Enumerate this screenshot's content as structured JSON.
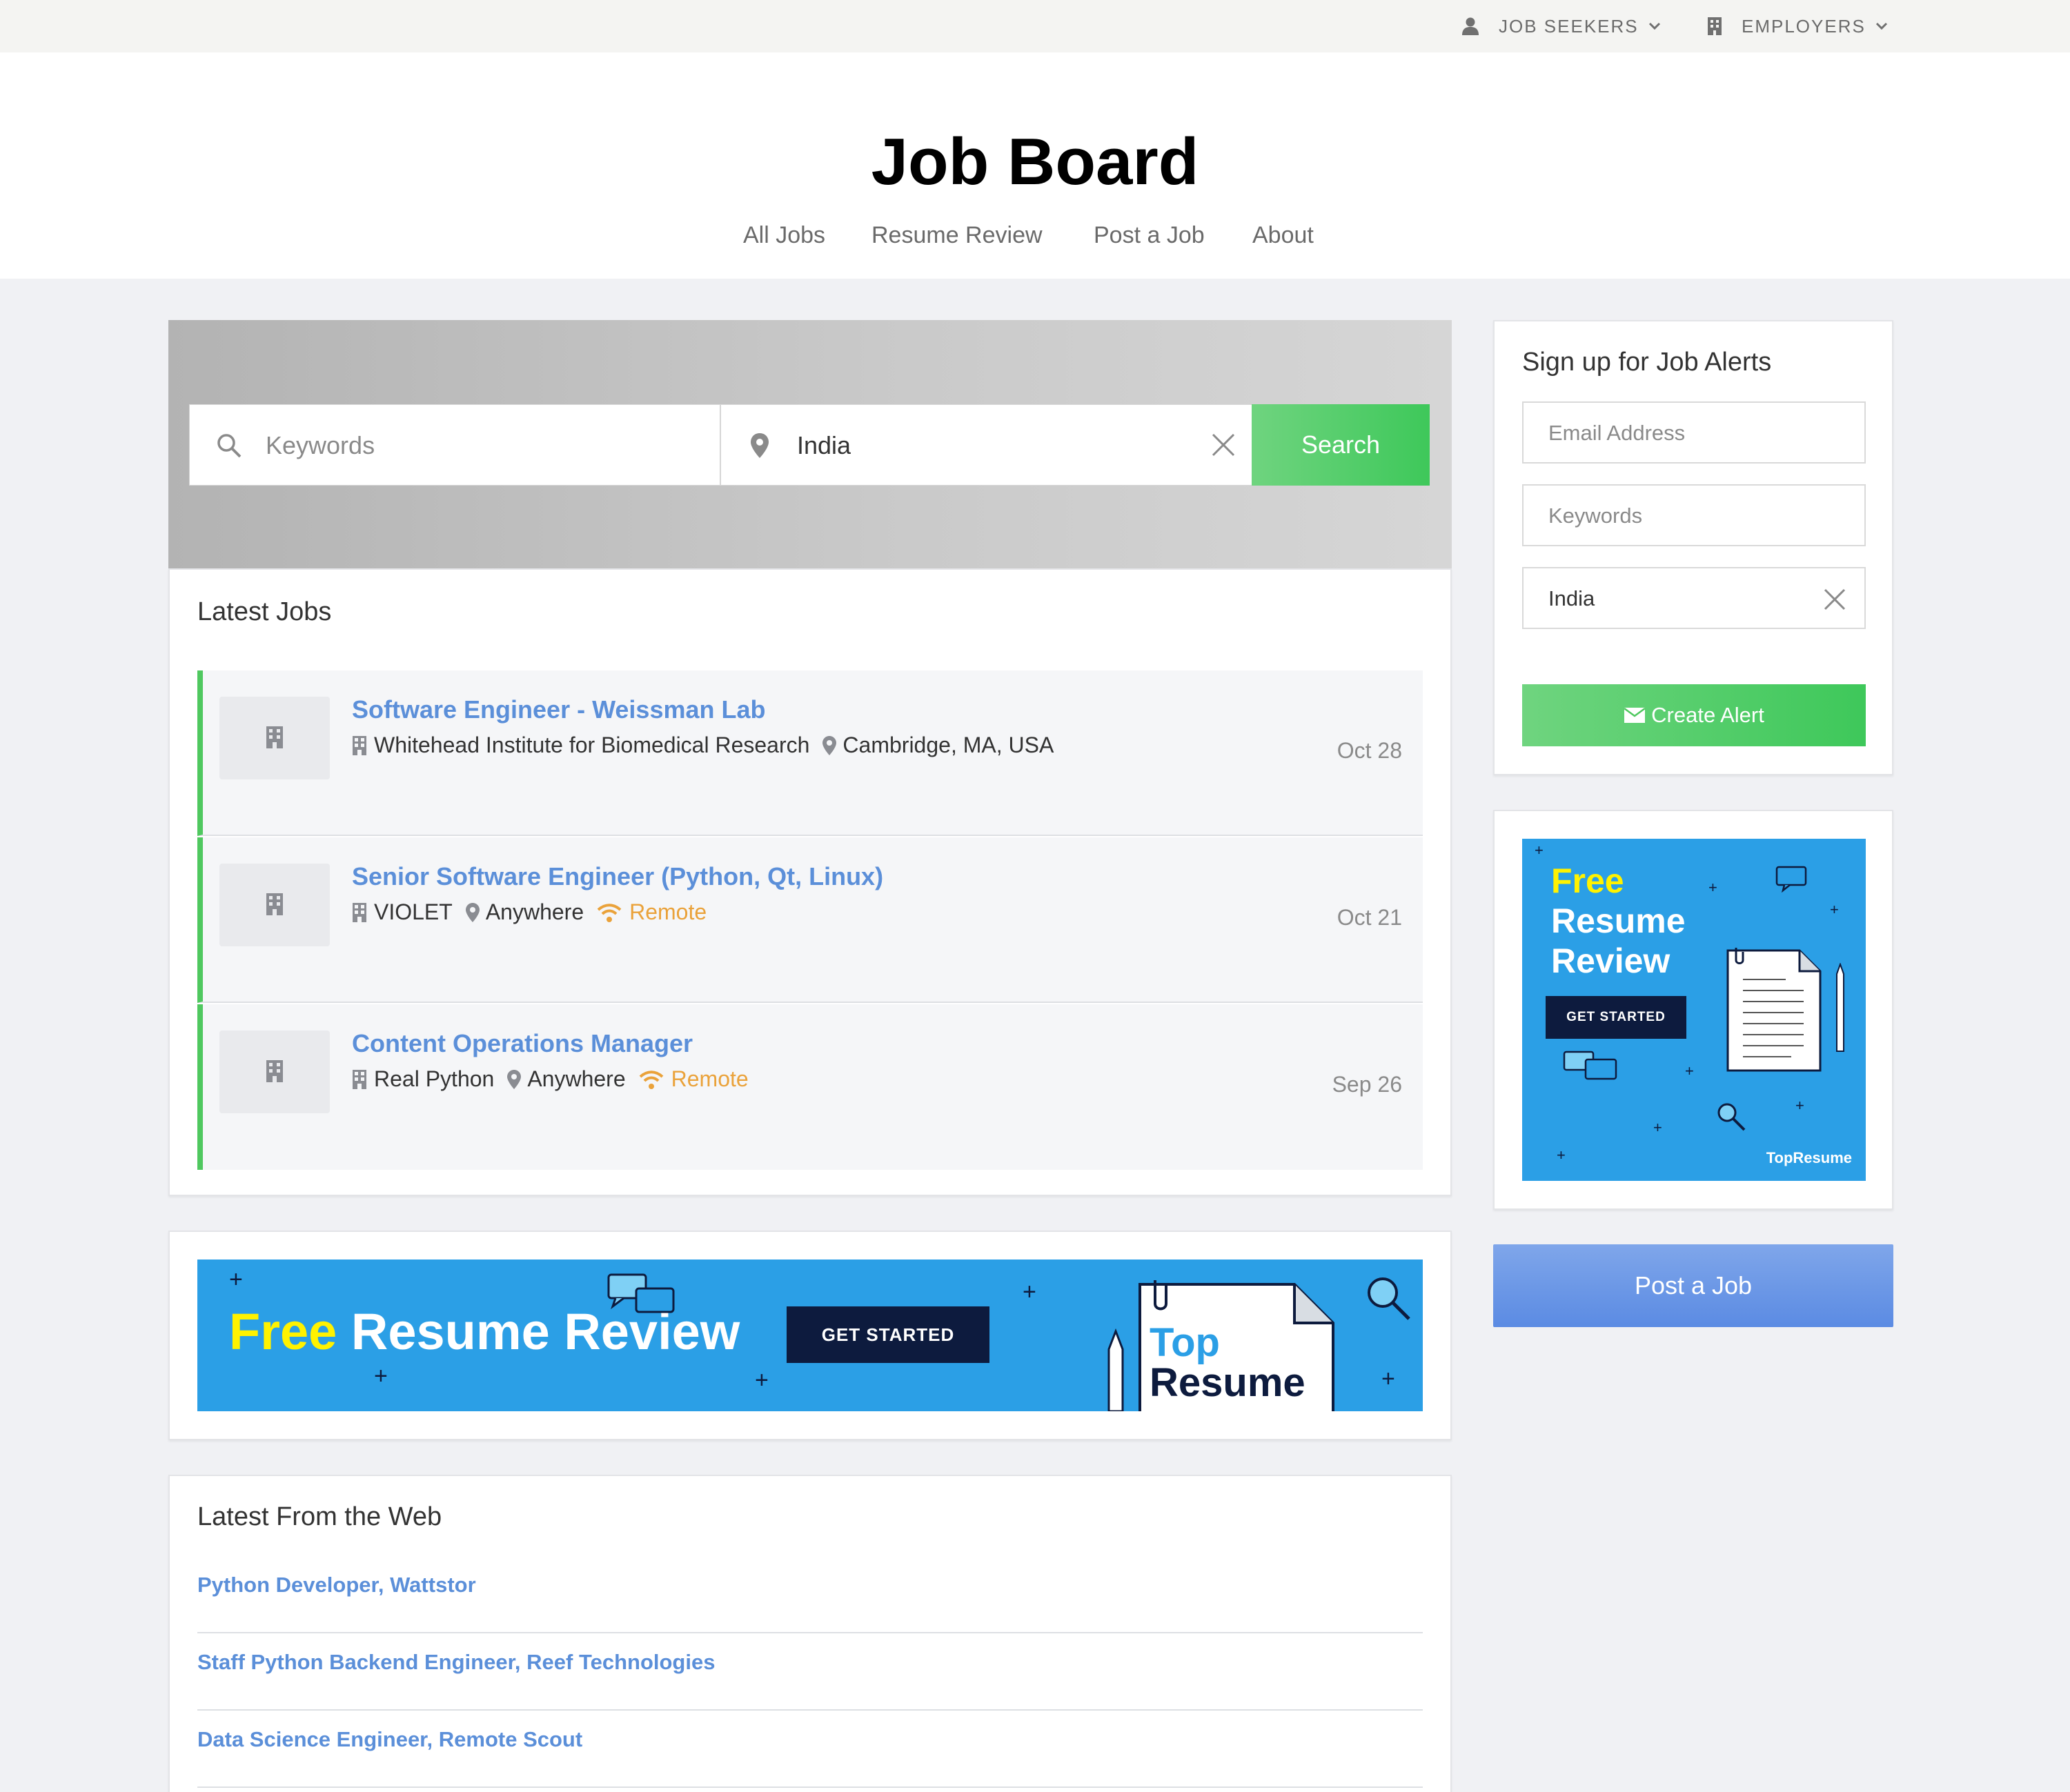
{
  "topbar": {
    "job_seekers": "JOB SEEKERS",
    "employers": "EMPLOYERS"
  },
  "header": {
    "title": "Job Board",
    "nav": [
      "All Jobs",
      "Resume Review",
      "Post a Job",
      "About"
    ]
  },
  "search": {
    "keywords_placeholder": "Keywords",
    "location_value": "India",
    "button_label": "Search"
  },
  "latest_jobs": {
    "title": "Latest Jobs",
    "jobs": [
      {
        "title": "Software Engineer - Weissman Lab",
        "company": "Whitehead Institute for Biomedical Research",
        "location": "Cambridge, MA, USA",
        "remote": "",
        "date": "Oct 28"
      },
      {
        "title": "Senior Software Engineer (Python, Qt, Linux)",
        "company": "VIOLET",
        "location": "Anywhere",
        "remote": "Remote",
        "date": "Oct 21"
      },
      {
        "title": "Content Operations Manager",
        "company": "Real Python",
        "location": "Anywhere",
        "remote": "Remote",
        "date": "Sep 26"
      }
    ]
  },
  "banner_ad": {
    "free": "Free",
    "headline": "Resume Review",
    "cta": "GET STARTED",
    "brand_top": "Top",
    "brand_bottom": "Resume"
  },
  "web": {
    "title": "Latest From the Web",
    "links": [
      "Python Developer, Wattstor",
      "Staff Python Backend Engineer, Reef Technologies",
      "Data Science Engineer, Remote Scout"
    ]
  },
  "alerts": {
    "title": "Sign up for Job Alerts",
    "email_placeholder": "Email Address",
    "keywords_placeholder": "Keywords",
    "location_value": "India",
    "button_label": "Create Alert"
  },
  "side_ad": {
    "line1": "Free",
    "line2": "Resume",
    "line3": "Review",
    "cta": "GET STARTED",
    "brand": "TopResume"
  },
  "post_job": {
    "label": "Post a Job"
  },
  "colors": {
    "accent_green": "#4fc85f",
    "link_blue": "#5b8fd9",
    "remote_orange": "#eaa23a",
    "ad_blue": "#2b9fe6",
    "ad_yellow": "#fff200",
    "ad_navy": "#0d1b3e"
  }
}
